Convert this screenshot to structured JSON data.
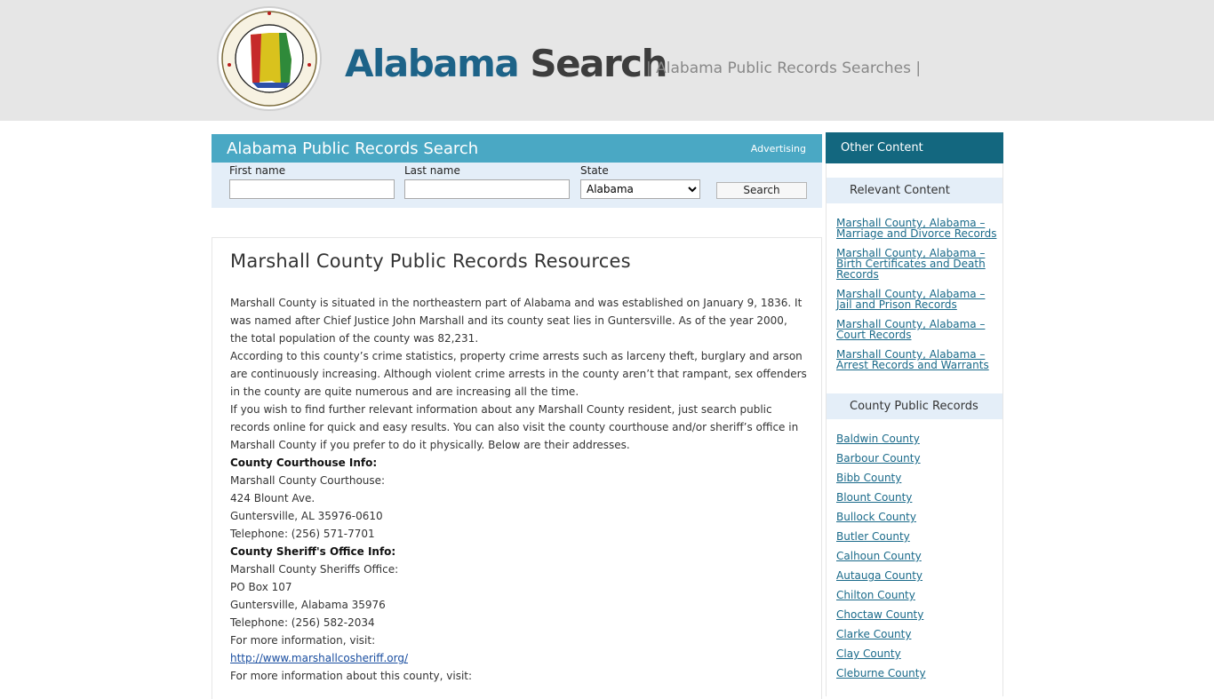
{
  "header": {
    "logo_part1": "Alabama",
    "logo_part2": "Search",
    "tagline": "| Alabama Public Records Searches |",
    "seal_icon": "state-of-alabama-seal"
  },
  "search": {
    "title": "Alabama Public Records Search",
    "advertising": "Advertising",
    "first_name_label": "First name",
    "last_name_label": "Last name",
    "state_label": "State",
    "state_value": "Alabama",
    "button_label": "Search"
  },
  "main": {
    "title": "Marshall County Public Records Resources",
    "para1": "Marshall County is situated in the northeastern part of Alabama and was established on January 9, 1836. It was named after Chief Justice John Marshall and its county seat lies in Guntersville. As of the year 2000, the total population of the county was 82,231.",
    "para2": "According to this county’s crime statistics, property crime arrests such as larceny theft, burglary and arson are continuously increasing. Although violent crime arrests in the county aren’t that rampant, sex offenders in the county are quite numerous and are increasing all the time.",
    "para3": "If you wish to find further relevant information about any Marshall County resident, just search public records online for quick and easy results. You can also visit the county courthouse and/or sheriff’s office in Marshall County if you prefer to do it physically. Below are their addresses.",
    "courthouse_heading": "County Courthouse Info:",
    "courthouse_lines": [
      "Marshall County Courthouse:",
      "424 Blount Ave.",
      "Guntersville, AL 35976-0610",
      "Telephone: (256) 571-7701"
    ],
    "sheriff_heading": "County Sheriff's Office Info:",
    "sheriff_lines": [
      "Marshall County Sheriffs Office:",
      "PO Box 107",
      "Guntersville, Alabama 35976",
      "Telephone: (256) 582-2034"
    ],
    "more_info": "For more information, visit:",
    "sheriff_link": "http://www.marshallcosheriff.org/",
    "more_info_county": "For more information about this county, visit:"
  },
  "sidebar": {
    "header": "Other Content",
    "relevant_title": "Relevant Content",
    "relevant_links": [
      [
        "Marshall County, Alabama –",
        "Marriage and Divorce Records"
      ],
      [
        "Marshall County, Alabama –",
        "Birth Certificates and Death",
        "Records"
      ],
      [
        "Marshall County, Alabama –",
        "Jail and Prison Records"
      ],
      [
        "Marshall County, Alabama –",
        "Court Records"
      ],
      [
        "Marshall County, Alabama –",
        "Arrest Records and Warrants"
      ]
    ],
    "county_title": "County Public Records",
    "counties": [
      "Baldwin County",
      "Barbour County",
      "Bibb County",
      "Blount County",
      "Bullock County",
      "Butler County",
      "Calhoun County",
      "Autauga County",
      "Chilton County",
      "Choctaw County",
      "Clarke County",
      "Clay County",
      "Cleburne County"
    ]
  },
  "colors": {
    "header_bg": "#e6e6e6",
    "logo_blue": "#1d6388",
    "search_bar": "#4aa8c4",
    "form_bg": "#e4eef8",
    "sidebar_head": "#13677f",
    "link": "#1a6a8a"
  }
}
